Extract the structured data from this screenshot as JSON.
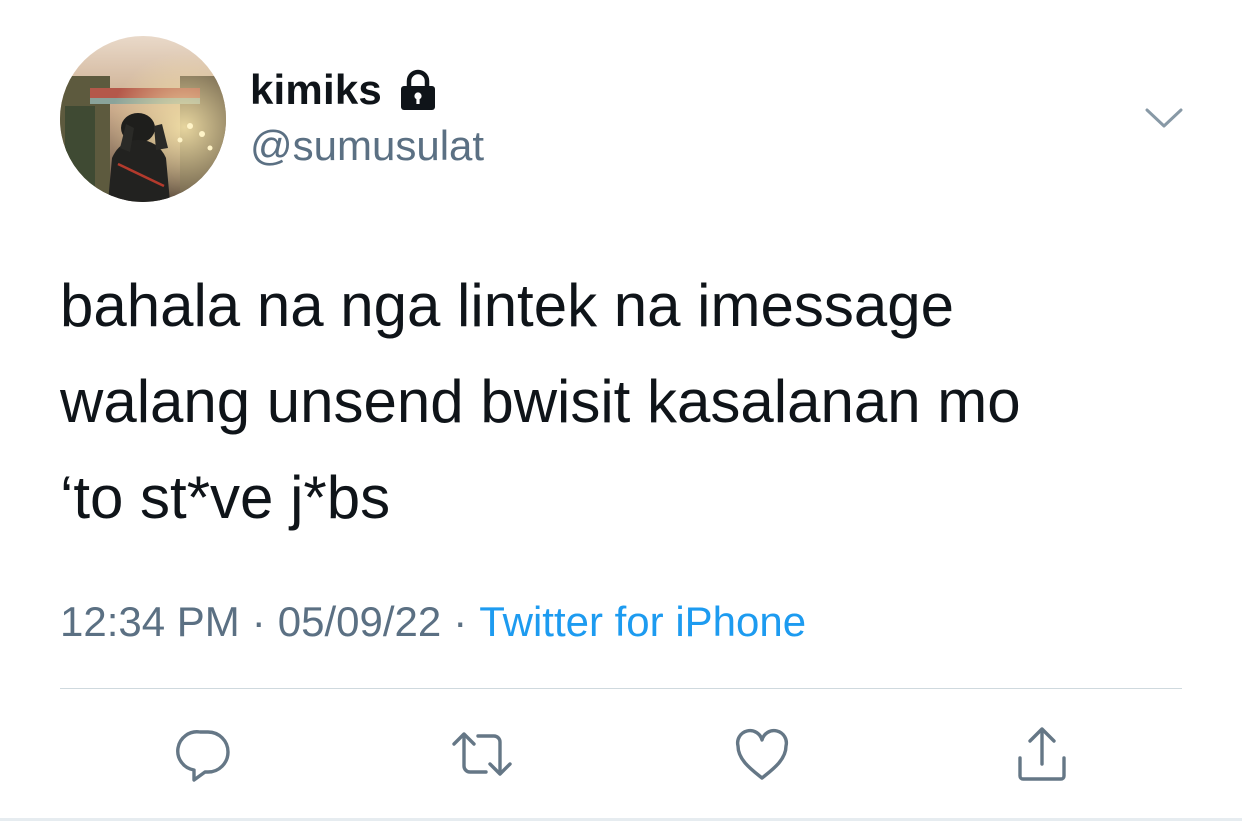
{
  "user": {
    "display_name": "kimiks",
    "handle": "@sumusulat",
    "locked": true
  },
  "tweet": {
    "text": "bahala na nga lintek na imessage\nwalang unsend bwisit kasalanan mo\n‘to st*ve j*bs",
    "time": "12:34 PM",
    "date": "05/09/22",
    "separator": "·",
    "source": "Twitter for iPhone"
  },
  "actions": [
    {
      "name": "reply",
      "icon": "reply-icon"
    },
    {
      "name": "retweet",
      "icon": "retweet-icon"
    },
    {
      "name": "like",
      "icon": "heart-icon"
    },
    {
      "name": "share",
      "icon": "share-icon"
    }
  ],
  "colors": {
    "text": "#0f1419",
    "secondary": "#5b7083",
    "link": "#1d9bf0",
    "divider": "#cfd9de"
  }
}
